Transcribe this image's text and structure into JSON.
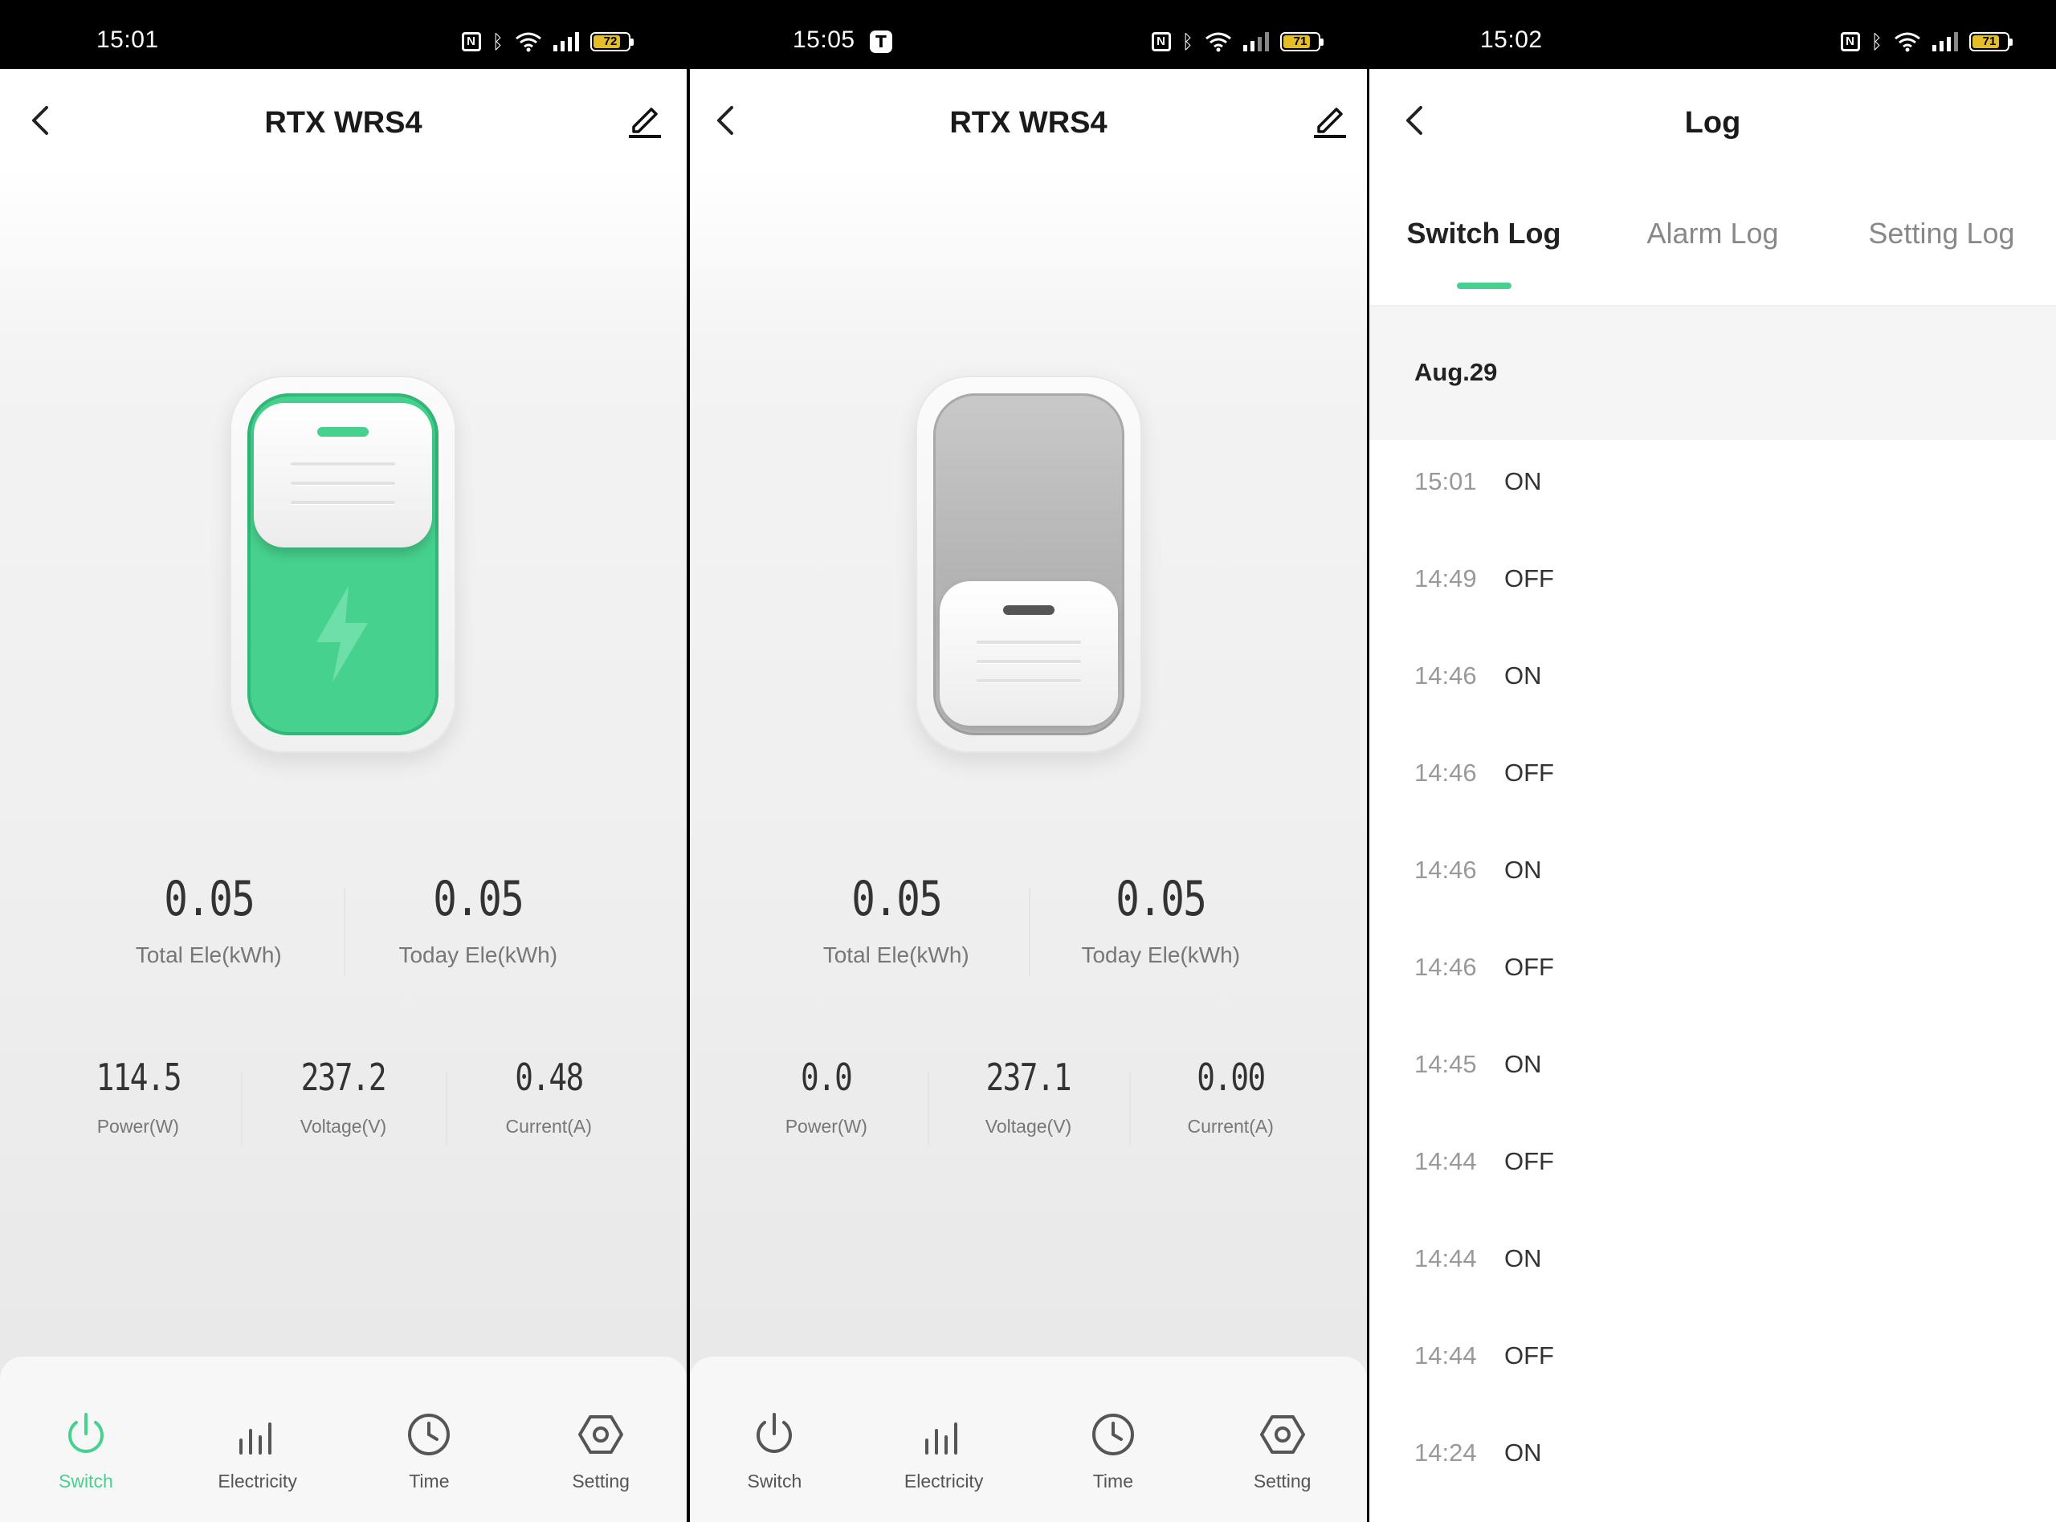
{
  "colors": {
    "accent": "#46d28e",
    "text": "#1a1a1a",
    "muted": "#777777",
    "battery": "#e3bd2a"
  },
  "screens": [
    {
      "status": {
        "time": "15:01",
        "battery": "72",
        "app_icon": ""
      },
      "title": "RTX WRS4",
      "switch_state": "on",
      "stats": {
        "total_ele": {
          "value": "0.05",
          "label": "Total Ele(kWh)"
        },
        "today_ele": {
          "value": "0.05",
          "label": "Today Ele(kWh)"
        },
        "power": {
          "value": "114.5",
          "label": "Power(W)"
        },
        "voltage": {
          "value": "237.2",
          "label": "Voltage(V)"
        },
        "current": {
          "value": "0.48",
          "label": "Current(A)"
        }
      },
      "tabs": [
        {
          "label": "Switch",
          "icon": "power-icon",
          "active": true
        },
        {
          "label": "Electricity",
          "icon": "bar-chart-icon",
          "active": false
        },
        {
          "label": "Time",
          "icon": "clock-icon",
          "active": false
        },
        {
          "label": "Setting",
          "icon": "hexagon-settings-icon",
          "active": false
        }
      ]
    },
    {
      "status": {
        "time": "15:05",
        "battery": "71",
        "app_icon": "T"
      },
      "title": "RTX WRS4",
      "switch_state": "off",
      "stats": {
        "total_ele": {
          "value": "0.05",
          "label": "Total Ele(kWh)"
        },
        "today_ele": {
          "value": "0.05",
          "label": "Today Ele(kWh)"
        },
        "power": {
          "value": "0.0",
          "label": "Power(W)"
        },
        "voltage": {
          "value": "237.1",
          "label": "Voltage(V)"
        },
        "current": {
          "value": "0.00",
          "label": "Current(A)"
        }
      },
      "tabs": [
        {
          "label": "Switch",
          "icon": "power-icon",
          "active": false
        },
        {
          "label": "Electricity",
          "icon": "bar-chart-icon",
          "active": false
        },
        {
          "label": "Time",
          "icon": "clock-icon",
          "active": false
        },
        {
          "label": "Setting",
          "icon": "hexagon-settings-icon",
          "active": false
        }
      ]
    },
    {
      "status": {
        "time": "15:02",
        "battery": "71",
        "app_icon": ""
      },
      "title": "Log",
      "log_tabs": [
        {
          "label": "Switch Log",
          "active": true
        },
        {
          "label": "Alarm Log",
          "active": false
        },
        {
          "label": "Setting Log",
          "active": false
        }
      ],
      "date": "Aug.29",
      "entries": [
        {
          "time": "15:01",
          "state": "ON"
        },
        {
          "time": "14:49",
          "state": "OFF"
        },
        {
          "time": "14:46",
          "state": "ON"
        },
        {
          "time": "14:46",
          "state": "OFF"
        },
        {
          "time": "14:46",
          "state": "ON"
        },
        {
          "time": "14:46",
          "state": "OFF"
        },
        {
          "time": "14:45",
          "state": "ON"
        },
        {
          "time": "14:44",
          "state": "OFF"
        },
        {
          "time": "14:44",
          "state": "ON"
        },
        {
          "time": "14:44",
          "state": "OFF"
        },
        {
          "time": "14:24",
          "state": "ON"
        }
      ]
    }
  ]
}
